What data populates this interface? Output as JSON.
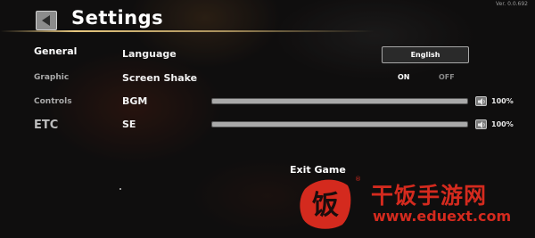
{
  "version": "Ver. 0.0.692",
  "header": {
    "title": "Settings",
    "back_icon": "triangle-left-icon"
  },
  "sidebar": {
    "items": [
      {
        "label": "General",
        "active": true
      },
      {
        "label": "Graphic",
        "active": false
      },
      {
        "label": "Controls",
        "active": false
      },
      {
        "label": "ETC",
        "active": false
      }
    ]
  },
  "settings": {
    "language": {
      "label": "Language",
      "value": "English"
    },
    "screen_shake": {
      "label": "Screen Shake",
      "on_label": "ON",
      "off_label": "OFF",
      "selected": "ON"
    },
    "bgm": {
      "label": "BGM",
      "level": 1.0,
      "percent": "100%"
    },
    "se": {
      "label": "SE",
      "level": 1.0,
      "percent": "100%"
    }
  },
  "exit_label": "Exit Game",
  "watermark": {
    "chinese": "干饭手游网",
    "url": "www.eduext.com",
    "registered": "®",
    "logo_char": "饭"
  },
  "colors": {
    "accent_line": "#ffdc8c",
    "watermark_red": "#d42a1e"
  }
}
